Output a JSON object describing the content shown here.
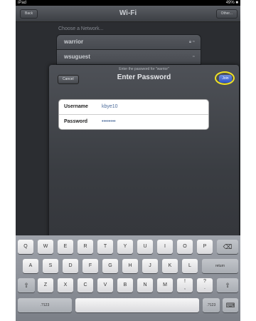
{
  "status_bar": {
    "device": "iPad",
    "battery": "49% ■"
  },
  "nav": {
    "back": "Back",
    "title": "Wi-Fi",
    "other": "Other..."
  },
  "network_section": {
    "header": "Choose a Network...",
    "networks": [
      "warrior",
      "wsuguest"
    ],
    "network_icons": [
      "lock-icon",
      "wifi-icon"
    ]
  },
  "dialog": {
    "prompt": "Enter the password for \"warrior\"",
    "title": "Enter Password",
    "cancel": "Cancel",
    "join": "Join",
    "fields": [
      {
        "label": "Username",
        "value": "kbye10"
      },
      {
        "label": "Password",
        "value": "••••••••"
      }
    ],
    "highlight_color": "#f0e223",
    "join_color": "#2f55c8"
  },
  "keyboard": {
    "row1": [
      "Q",
      "W",
      "E",
      "R",
      "T",
      "Y",
      "U",
      "I",
      "O",
      "P",
      "⌫"
    ],
    "row2": [
      "A",
      "S",
      "D",
      "F",
      "G",
      "H",
      "J",
      "K",
      "L",
      "return"
    ],
    "row3": [
      "⇧",
      "Z",
      "X",
      "C",
      "V",
      "B",
      "N",
      "M",
      "!",
      ",",
      "?",
      ".",
      "⇧"
    ],
    "row4": [
      ".?123",
      "",
      ".?123",
      "⌨"
    ]
  }
}
